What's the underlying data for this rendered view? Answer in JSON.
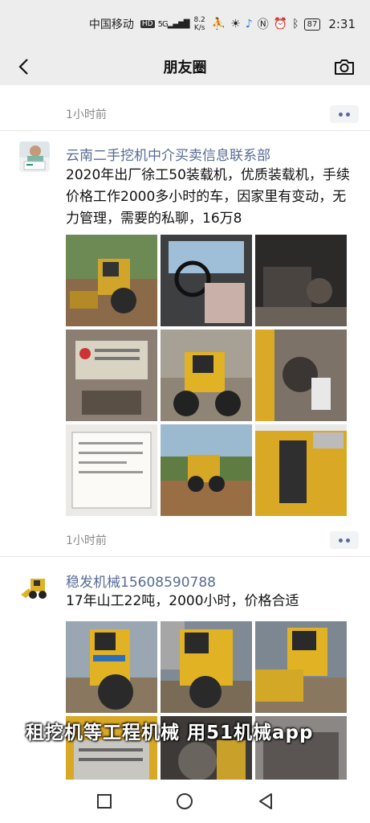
{
  "status_bar": {
    "carrier": "中国移动",
    "hd": "HD",
    "signal": "5G",
    "speed_value": "8.2",
    "speed_unit": "K/s",
    "battery": "87",
    "time": "2:31"
  },
  "nav": {
    "title": "朋友圈"
  },
  "posts": [
    {
      "time": "1小时前",
      "author": "云南二手挖机中介买卖信息联系部",
      "text": "2020年出厂徐工50装载机，优质装载机，手续价格工作2000多小时的车，因家里有变动，无力管理，需要的私聊，16万8",
      "photos": [
        "装载机正面",
        "驾驶室",
        "发动机",
        "铭牌",
        "装载机",
        "滤清器",
        "合格证",
        "装载机侧面",
        "机身"
      ]
    },
    {
      "time": "1小时前",
      "author": "稳发机械15608590788",
      "text": "17年山工22吨，2000小时，价格合适",
      "photos": [
        "压路机",
        "压路机",
        "压路机",
        "铭牌",
        "发动机",
        "机身"
      ]
    }
  ],
  "watermark": "租挖机等工程机械 用51机械app",
  "colors": {
    "link": "#576b95",
    "background": "#ededed",
    "machine_yellow": "#e0b224"
  }
}
